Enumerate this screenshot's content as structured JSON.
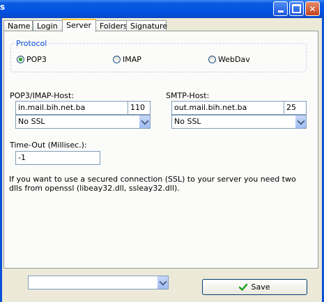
{
  "window": {
    "title_glyph": "s",
    "minimize_label": "minimize",
    "maximize_label": "maximize",
    "close_label": "close"
  },
  "tabs": [
    {
      "label": "Name"
    },
    {
      "label": "Login"
    },
    {
      "label": "Server"
    },
    {
      "label": "Folders"
    },
    {
      "label": "Signature"
    }
  ],
  "active_tab": "Server",
  "protocol": {
    "legend": "Protocol",
    "options": [
      {
        "label": "POP3",
        "selected": true
      },
      {
        "label": "IMAP",
        "selected": false
      },
      {
        "label": "WebDav",
        "selected": false
      }
    ]
  },
  "incoming": {
    "label": "POP3/IMAP-Host:",
    "host": "in.mail.bih.net.ba",
    "port": "110",
    "ssl": "No SSL"
  },
  "outgoing": {
    "label": "SMTP-Host:",
    "host": "out.mail.bih.net.ba",
    "port": "25",
    "ssl": "No SSL"
  },
  "timeout": {
    "label": "Time-Out (Millisec.):",
    "value": "-1"
  },
  "note": "If you want to use a secured connection (SSL) to your server you need two dlls from openssl (libeay32.dll, ssleay32.dll).",
  "footer": {
    "dropdown_value": "",
    "save_label": "Save"
  },
  "colors": {
    "titlebar": "#0053E2",
    "window_bg": "#ECE9D8",
    "panel_bg": "#FBFBF9",
    "legend_text": "#0046D5",
    "radio_selected": "#21A121",
    "tab_highlight": "#FFC83C"
  },
  "icons": {
    "titlebar_minimize": "minimize-icon",
    "titlebar_maximize": "maximize-icon",
    "titlebar_close": "close-icon",
    "combo_arrow": "chevron-down-icon",
    "save": "checkmark-icon"
  }
}
